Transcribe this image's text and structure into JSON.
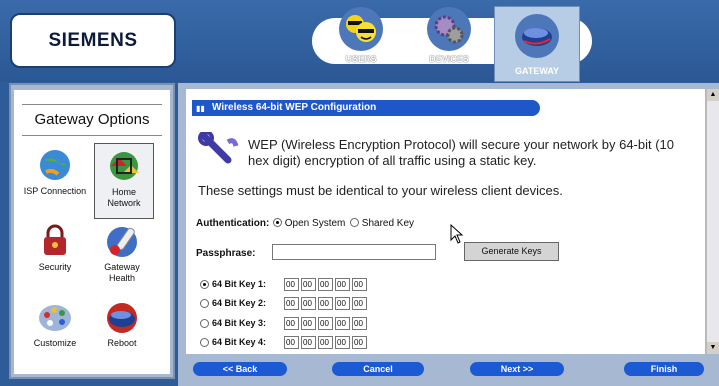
{
  "header": {
    "brand": "SIEMENS",
    "tabs": [
      {
        "label": "USERS",
        "icon": "users-icon"
      },
      {
        "label": "DEVICES",
        "icon": "devices-icon"
      },
      {
        "label": "GATEWAY",
        "icon": "gateway-icon",
        "active": true
      }
    ]
  },
  "sidebar": {
    "title": "Gateway Options",
    "items": [
      {
        "label": "ISP Connection",
        "icon": "isp-connection-icon"
      },
      {
        "label": "Home Network",
        "icon": "home-network-icon",
        "selected": true
      },
      {
        "label": "Security",
        "icon": "security-icon"
      },
      {
        "label": "Gateway Health",
        "icon": "gateway-health-icon"
      },
      {
        "label": "Customize",
        "icon": "customize-icon"
      },
      {
        "label": "Reboot",
        "icon": "reboot-icon"
      }
    ]
  },
  "main": {
    "section_title": "Wireless 64-bit WEP Configuration",
    "description": "WEP (Wireless Encryption Protocol) will secure your network by 64-bit (10 hex digit) encryption of all traffic using a static key.",
    "note": "These settings must be identical to your wireless client devices.",
    "auth_label": "Authentication:",
    "auth_options": [
      "Open System",
      "Shared Key"
    ],
    "auth_selected": "Open System",
    "passphrase_label": "Passphrase:",
    "passphrase_value": "",
    "generate_label": "Generate Keys",
    "keys": [
      {
        "label": "64 Bit Key 1:",
        "selected": true,
        "values": [
          "00",
          "00",
          "00",
          "00",
          "00"
        ]
      },
      {
        "label": "64 Bit Key 2:",
        "selected": false,
        "values": [
          "00",
          "00",
          "00",
          "00",
          "00"
        ]
      },
      {
        "label": "64 Bit Key 3:",
        "selected": false,
        "values": [
          "00",
          "00",
          "00",
          "00",
          "00"
        ]
      },
      {
        "label": "64 Bit Key 4:",
        "selected": false,
        "values": [
          "00",
          "00",
          "00",
          "00",
          "00"
        ]
      }
    ]
  },
  "nav": {
    "back": "<< Back",
    "cancel": "Cancel",
    "next": "Next >>",
    "finish": "Finish"
  },
  "colors": {
    "accent": "#1b5ad2",
    "frame": "#2e5c98"
  }
}
